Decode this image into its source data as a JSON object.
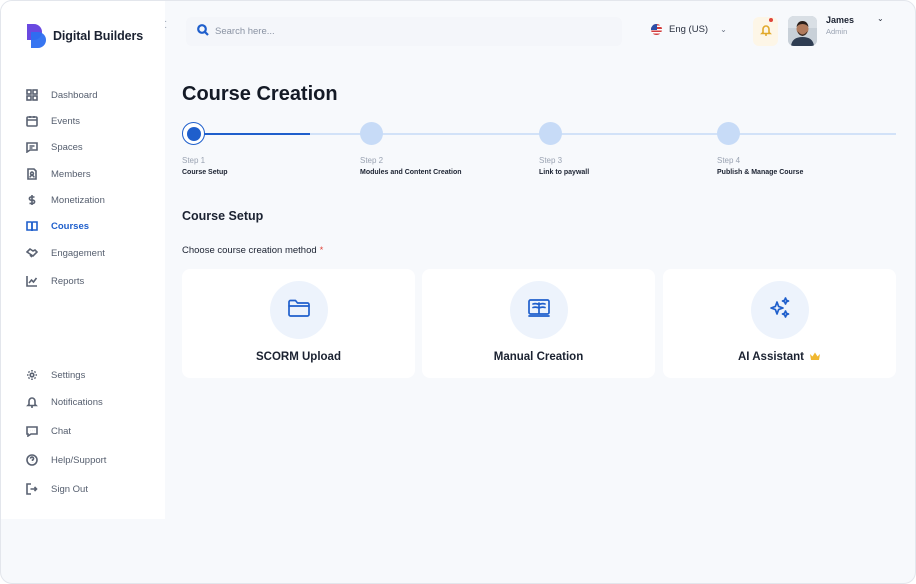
{
  "brand": {
    "name": "Digital Builders"
  },
  "search": {
    "placeholder": "Search here..."
  },
  "language": {
    "label": "Eng (US)"
  },
  "user": {
    "name": "James",
    "role": "Admin"
  },
  "sidebar": {
    "main_items": [
      {
        "label": "Dashboard",
        "icon": "dashboard-icon"
      },
      {
        "label": "Events",
        "icon": "calendar-icon"
      },
      {
        "label": "Spaces",
        "icon": "message-square-icon"
      },
      {
        "label": "Members",
        "icon": "document-user-icon"
      },
      {
        "label": "Monetization",
        "icon": "dollar-icon"
      },
      {
        "label": "Courses",
        "icon": "book-open-icon",
        "active": true
      },
      {
        "label": "Engagement",
        "icon": "handshake-icon"
      },
      {
        "label": "Reports",
        "icon": "line-chart-icon"
      }
    ],
    "bottom_items": [
      {
        "label": "Settings",
        "icon": "gear-icon"
      },
      {
        "label": "Notifications",
        "icon": "bell-icon"
      },
      {
        "label": "Chat",
        "icon": "chat-icon"
      },
      {
        "label": "Help/Support",
        "icon": "help-circle-icon"
      },
      {
        "label": "Sign Out",
        "icon": "sign-out-icon"
      }
    ]
  },
  "main": {
    "title": "Course Creation",
    "steps": [
      {
        "num": "Step 1",
        "name": "Course Setup",
        "state": "current"
      },
      {
        "num": "Step 2",
        "name": "Modules and Content Creation",
        "state": "upcoming"
      },
      {
        "num": "Step 3",
        "name": "Link to paywall",
        "state": "upcoming"
      },
      {
        "num": "Step 4",
        "name": "Publish & Manage Course",
        "state": "upcoming"
      }
    ],
    "section_title": "Course Setup",
    "method_label": "Choose course creation method",
    "required_mark": "*",
    "methods": [
      {
        "label": "SCORM Upload",
        "icon": "folder-icon"
      },
      {
        "label": "Manual Creation",
        "icon": "open-book-icon"
      },
      {
        "label": "AI Assistant",
        "icon": "sparkles-icon",
        "badge_icon": "crown-icon"
      }
    ]
  },
  "colors": {
    "accent": "#1f5fcc",
    "step_inactive": "#c7dbf7",
    "background": "#f7f9fc",
    "bell_bg": "#fdf6e7",
    "crown": "#f0b72f"
  }
}
